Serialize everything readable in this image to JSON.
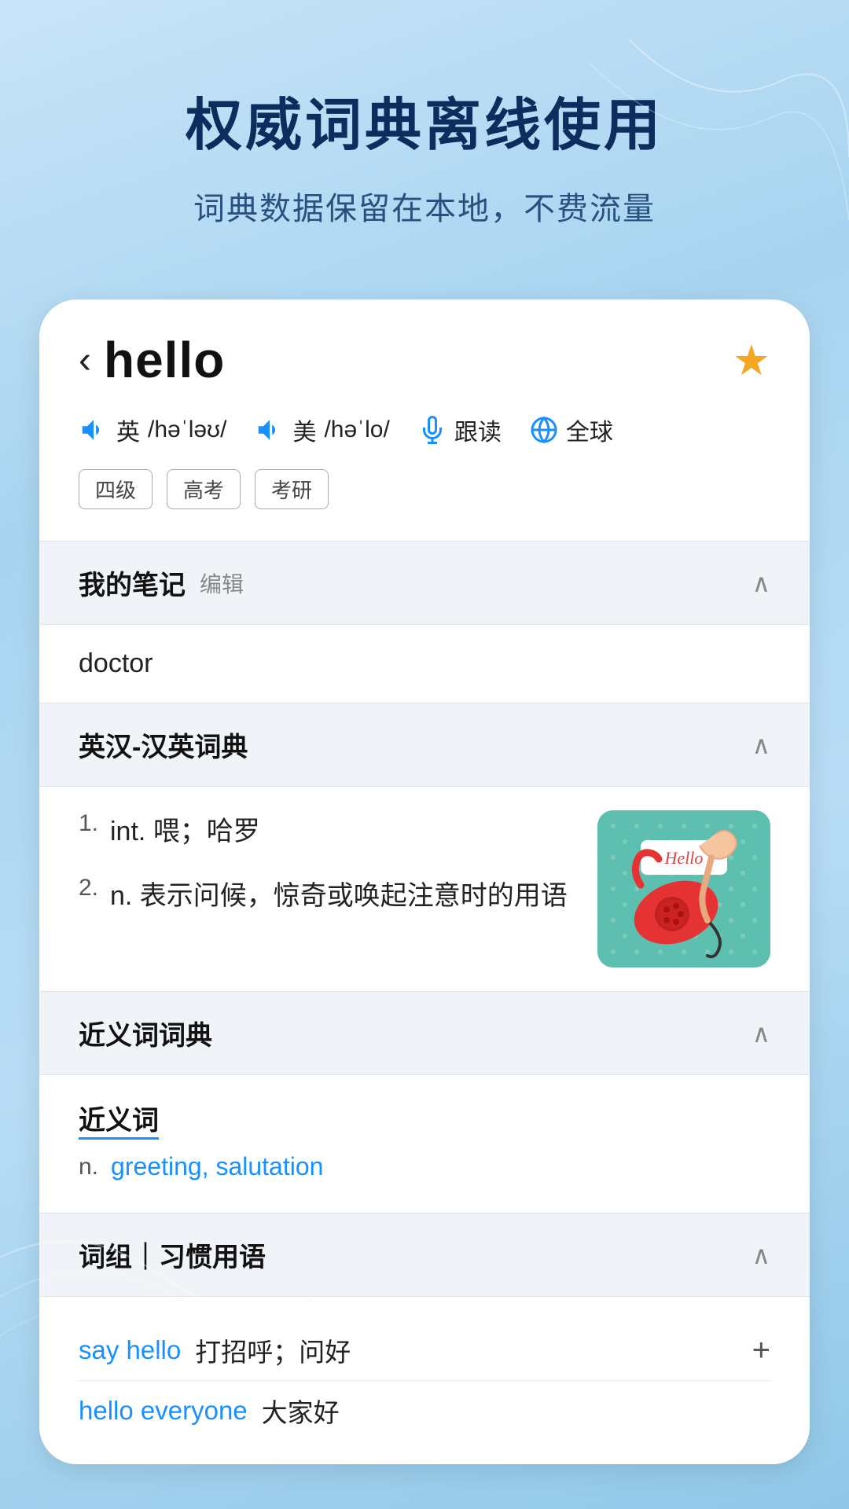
{
  "hero": {
    "title": "权威词典离线使用",
    "subtitle": "词典数据保留在本地，不费流量"
  },
  "word": {
    "back_label": "‹",
    "word": "hello",
    "star": "★",
    "pronunciations": [
      {
        "flag": "英",
        "phonetic": "/həˈləʊ/",
        "icon": "speaker"
      },
      {
        "flag": "美",
        "phonetic": "/həˈlo/",
        "icon": "speaker"
      }
    ],
    "actions": [
      {
        "label": "跟读",
        "icon": "mic"
      },
      {
        "label": "全球",
        "icon": "globe"
      }
    ],
    "tags": [
      "四级",
      "高考",
      "考研"
    ]
  },
  "sections": {
    "notes": {
      "title": "我的笔记",
      "edit_label": "编辑",
      "content": "doctor",
      "collapsed": false
    },
    "en_cn_dict": {
      "title": "英汉-汉英词典",
      "collapsed": false,
      "definitions": [
        {
          "number": "1.",
          "pos": "int.",
          "text": "喂；哈罗"
        },
        {
          "number": "2.",
          "pos": "n.",
          "text": "表示问候，惊奇或唤起注意时的用语"
        }
      ]
    },
    "synonym_dict": {
      "title": "近义词词典",
      "collapsed": false,
      "synonym_label": "近义词",
      "pos": "n.",
      "synonyms": "greeting, salutation"
    },
    "phrases": {
      "title": "词组｜习惯用语",
      "collapsed": false,
      "items": [
        {
          "phrase": "say hello",
          "meaning": "打招呼；问好"
        },
        {
          "phrase": "hello everyone",
          "meaning": "大家好"
        }
      ]
    }
  }
}
